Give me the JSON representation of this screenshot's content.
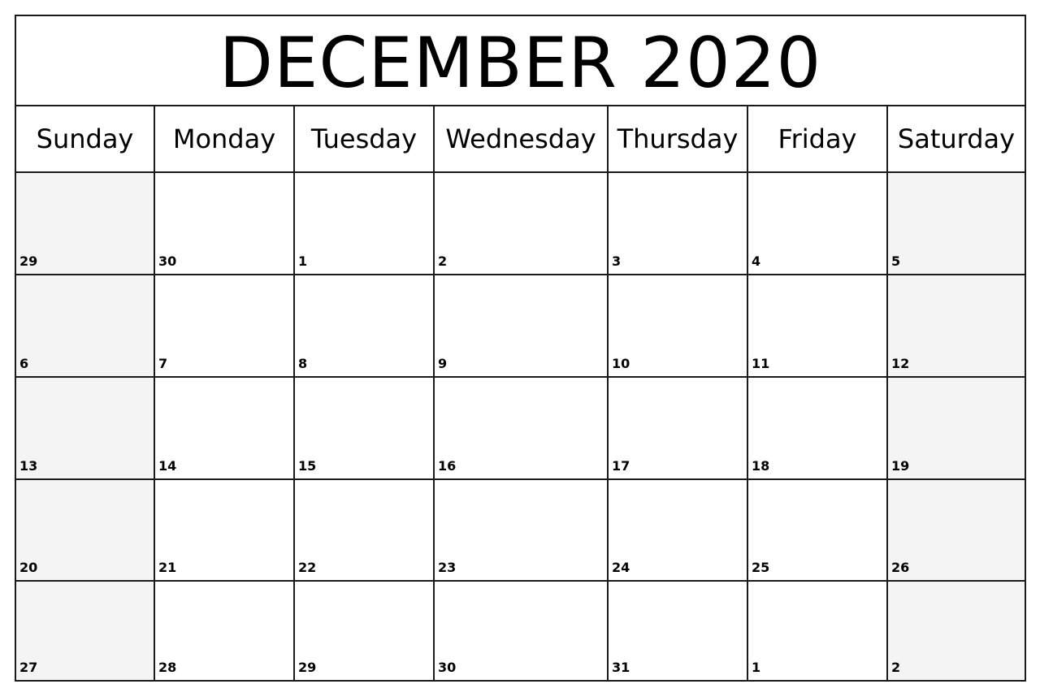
{
  "title": "DECEMBER 2020",
  "weekdays": [
    "Sunday",
    "Monday",
    "Tuesday",
    "Wednesday",
    "Thursday",
    "Friday",
    "Saturday"
  ],
  "weeks": [
    [
      "29",
      "30",
      "1",
      "2",
      "3",
      "4",
      "5"
    ],
    [
      "6",
      "7",
      "8",
      "9",
      "10",
      "11",
      "12"
    ],
    [
      "13",
      "14",
      "15",
      "16",
      "17",
      "18",
      "19"
    ],
    [
      "20",
      "21",
      "22",
      "23",
      "24",
      "25",
      "26"
    ],
    [
      "27",
      "28",
      "29",
      "30",
      "31",
      "1",
      "2"
    ]
  ],
  "colors": {
    "weekend_bg": "#f4f4f4",
    "grid": "#1a1a1a"
  }
}
